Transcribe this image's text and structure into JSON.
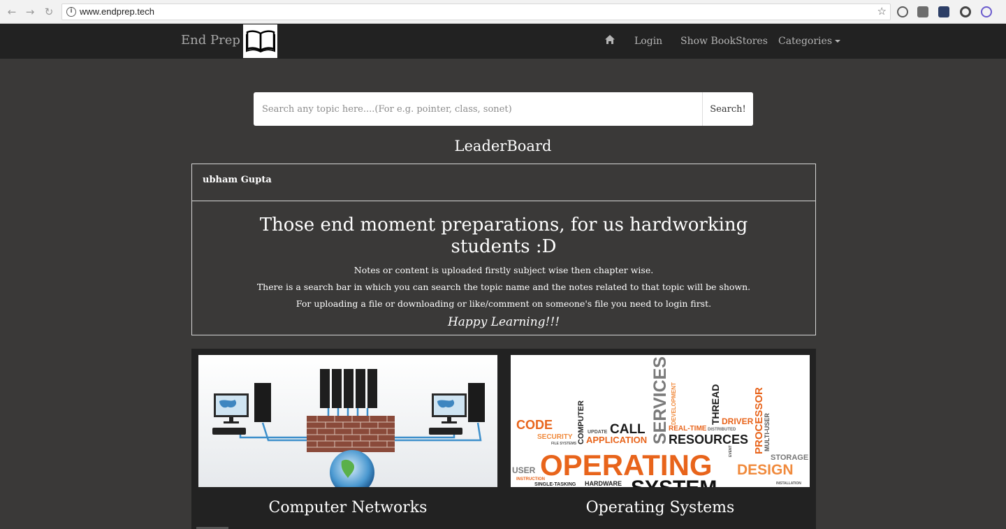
{
  "browser": {
    "url": "www.endprep.tech",
    "back_icon": "←",
    "forward_icon": "→",
    "reload_icon": "↻",
    "info_icon": "i",
    "star_icon": "☆"
  },
  "navbar": {
    "brand": "End Prep",
    "links": {
      "login": "Login",
      "bookstores": "Show BookStores",
      "categories": "Categories"
    }
  },
  "search": {
    "placeholder": "Search any topic here....(For e.g. pointer, class, sonet)",
    "button": "Search!"
  },
  "leaderboard": {
    "title": "LeaderBoard",
    "entry": "ubham Gupta"
  },
  "intro": {
    "heading": "Those end moment preparations, for us hardworking students :D",
    "line1": "Notes or content is uploaded firstly subject wise then chapter wise.",
    "line2": "There is a search bar in which you can search the topic name and the notes related to that topic will be shown.",
    "line3": "For uploading a file or downloading or like/comment on someone's file you need to login first.",
    "closing": "Happy Learning!!!"
  },
  "categories": [
    {
      "title": "Computer Networks"
    },
    {
      "title": "Operating Systems",
      "cloud_words": {
        "code": "CODE",
        "security": "SECURITY",
        "file_systems": "FILE SYSTEMS",
        "computer": "COMPUTER",
        "update": "UPDATE",
        "call": "CALL",
        "application": "APPLICATION",
        "services": "SERVICES",
        "development": "DEVELOPMENT",
        "real_time": "REAL-TIME",
        "distributed": "DISTRIBUTED",
        "resources": "RESOURCES",
        "thread": "THREAD",
        "driver": "DRIVER",
        "processor": "PROCESSOR",
        "multi_user": "MULTI-USER",
        "storage": "STORAGE",
        "operating": "OPERATING",
        "design": "DESIGN",
        "user": "USER",
        "instruction": "INSTRUCTION",
        "single_tasking": "SINGLE-TASKING",
        "hardware": "HARDWARE",
        "system": "SYSTEM",
        "installation": "INSTALLATION",
        "event": "EVENT"
      }
    }
  ],
  "colors": {
    "background": "#3a3938",
    "navbar": "#222222",
    "cloud_orange": "#e8641b",
    "cloud_dark": "#1a1a1a",
    "cloud_gray": "#888888"
  }
}
